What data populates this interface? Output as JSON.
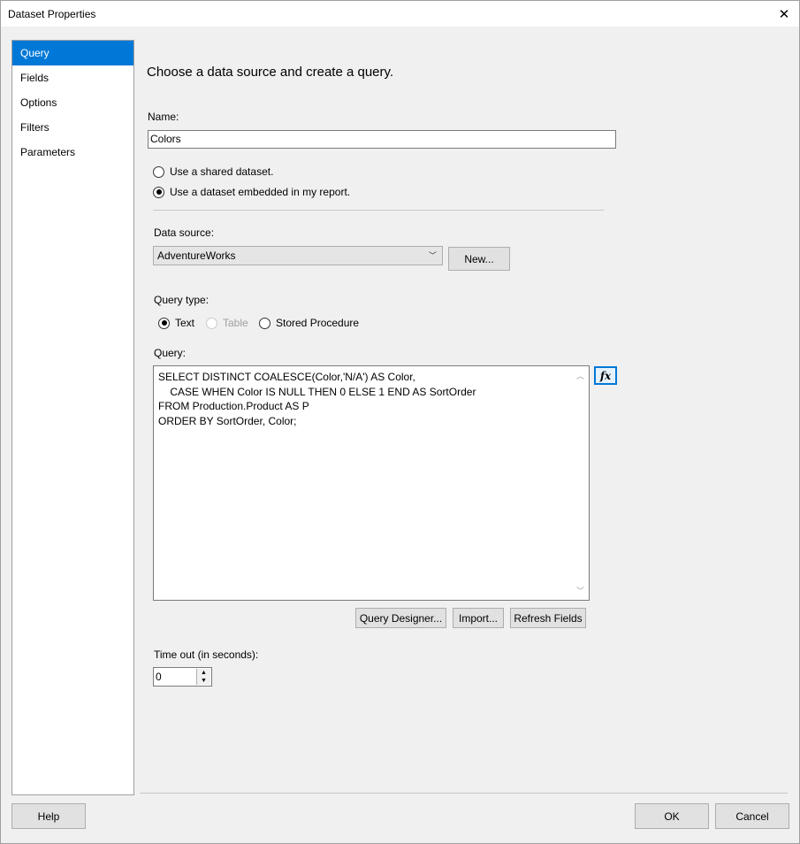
{
  "window": {
    "title": "Dataset Properties",
    "close_glyph": "✕"
  },
  "nav": {
    "items": [
      {
        "label": "Query",
        "selected": true
      },
      {
        "label": "Fields",
        "selected": false
      },
      {
        "label": "Options",
        "selected": false
      },
      {
        "label": "Filters",
        "selected": false
      },
      {
        "label": "Parameters",
        "selected": false
      }
    ]
  },
  "main": {
    "heading": "Choose a data source and create a query.",
    "name_label": "Name:",
    "name_value": "Colors",
    "dataset_options": {
      "shared_label": "Use a shared dataset.",
      "embedded_label": "Use a dataset embedded in my report.",
      "selected": "embedded"
    },
    "data_source_label": "Data source:",
    "data_source_value": "AdventureWorks",
    "new_button": "New...",
    "query_type_label": "Query type:",
    "query_types": {
      "text": "Text",
      "table": "Table",
      "stored_procedure": "Stored Procedure",
      "selected": "text"
    },
    "query_label": "Query:",
    "query_text": "SELECT DISTINCT COALESCE(Color,'N/A') AS Color,\n    CASE WHEN Color IS NULL THEN 0 ELSE 1 END AS SortOrder\nFROM Production.Product AS P\nORDER BY SortOrder, Color;",
    "fx_label": "fx",
    "query_designer_button": "Query Designer...",
    "import_button": "Import...",
    "refresh_fields_button": "Refresh Fields",
    "timeout_label": "Time out (in seconds):",
    "timeout_value": "0"
  },
  "footer": {
    "help_button": "Help",
    "ok_button": "OK",
    "cancel_button": "Cancel"
  },
  "colors": {
    "accent": "#0078d7",
    "background": "#f0f0f0"
  }
}
